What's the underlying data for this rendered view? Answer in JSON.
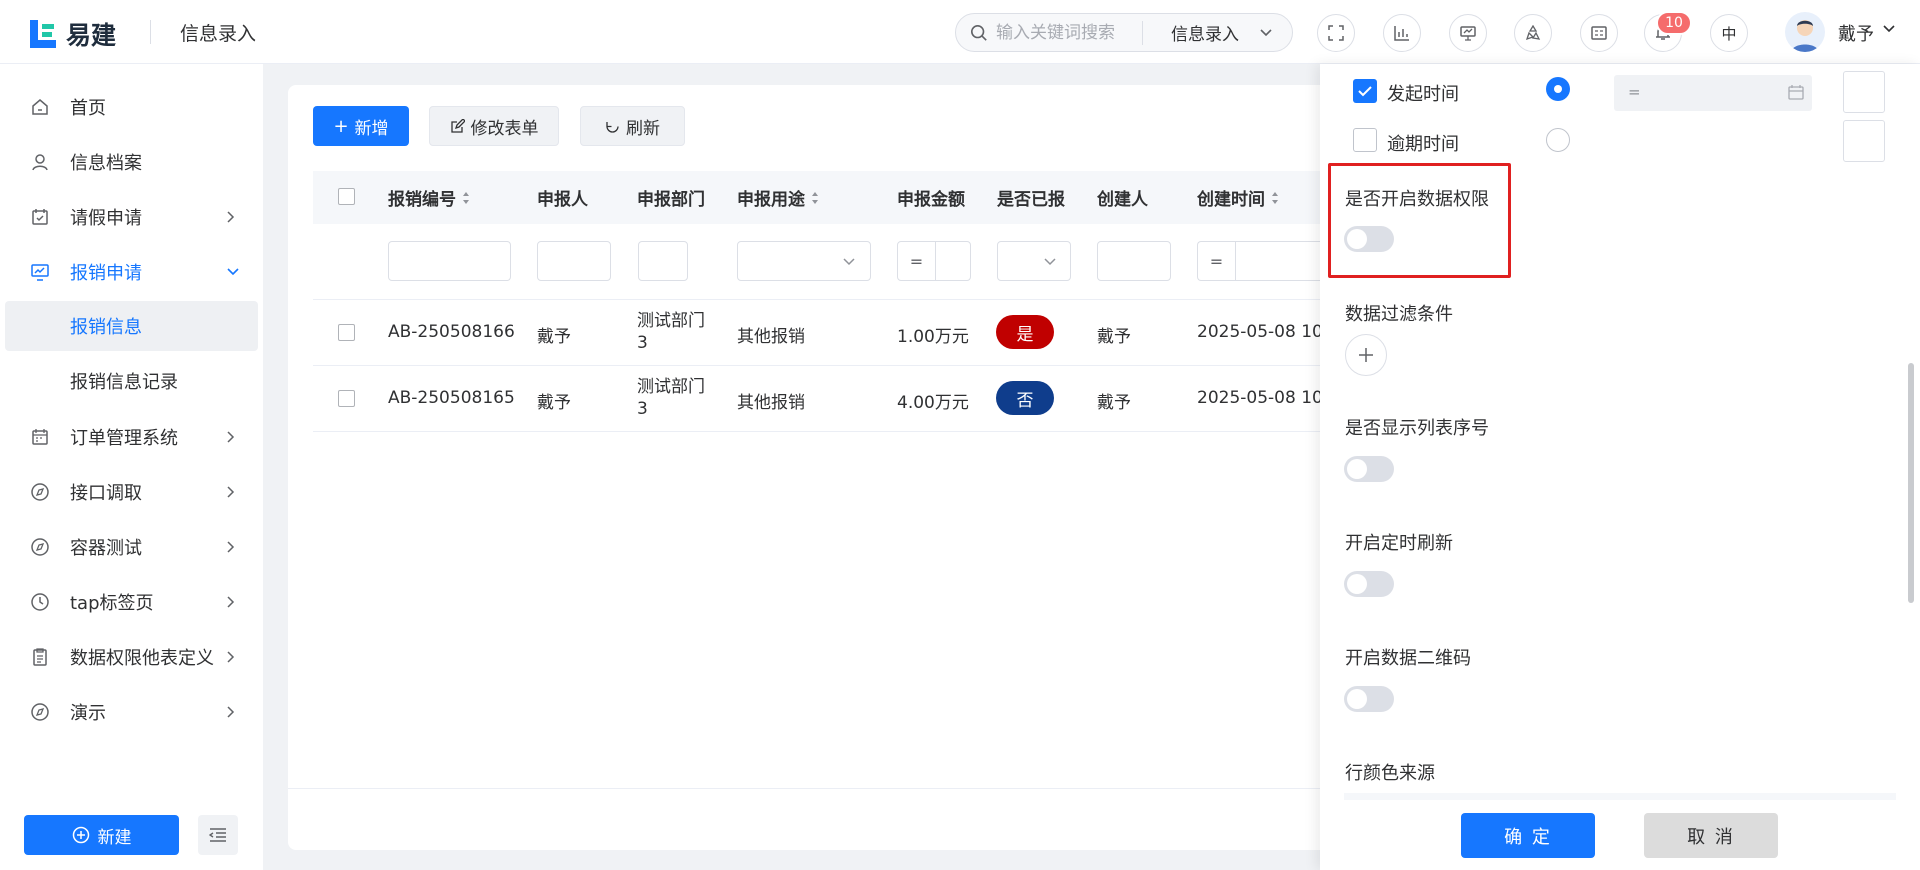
{
  "header": {
    "logo_text": "易建",
    "page_title": "信息录入",
    "search_placeholder": "输入关键词搜索",
    "search_scope": "信息录入",
    "notification_count": "10",
    "lang": "中",
    "user_name": "戴予"
  },
  "sidebar": {
    "items": [
      {
        "label": "首页",
        "icon": "home-icon"
      },
      {
        "label": "信息档案",
        "icon": "user-icon"
      },
      {
        "label": "请假申请",
        "icon": "calendar-check-icon"
      },
      {
        "label": "报销申请",
        "icon": "monitor-chart-icon"
      },
      {
        "label": "报销信息"
      },
      {
        "label": "报销信息记录"
      },
      {
        "label": "订单管理系统",
        "icon": "calendar-icon"
      },
      {
        "label": "接口调取",
        "icon": "compass-icon"
      },
      {
        "label": "容器测试",
        "icon": "compass-icon"
      },
      {
        "label": "tap标签页",
        "icon": "clock-icon"
      },
      {
        "label": "数据权限他表定义",
        "icon": "clipboard-icon"
      },
      {
        "label": "演示",
        "icon": "compass-icon"
      }
    ],
    "new_button": "新建"
  },
  "toolbar": {
    "add": "新增",
    "edit_form": "修改表单",
    "refresh": "刷新"
  },
  "table": {
    "columns": [
      "报销编号",
      "申报人",
      "申报部门",
      "申报用途",
      "申报金额",
      "是否已报",
      "创建人",
      "创建时间"
    ],
    "filter_eq": "=",
    "rows": [
      {
        "id": "AB-250508166",
        "applicant": "戴予",
        "dept_line1": "测试部门",
        "dept_line2": "3",
        "purpose": "其他报销",
        "amount": "1.00万元",
        "reported": "是",
        "creator": "戴予",
        "created": "2025-05-08 10"
      },
      {
        "id": "AB-250508165",
        "applicant": "戴予",
        "dept_line1": "测试部门",
        "dept_line2": "3",
        "purpose": "其他报销",
        "amount": "4.00万元",
        "reported": "否",
        "creator": "戴予",
        "created": "2025-05-08 10"
      }
    ]
  },
  "colors": {
    "primary": "#1677ff",
    "tag_yes": "#c00000",
    "tag_no": "#0f3d8c",
    "highlight": "#e02020"
  },
  "panel": {
    "field_start_time": "发起时间",
    "field_overdue_time": "逾期时间",
    "date_eq": "=",
    "enable_data_permission": "是否开启数据权限",
    "data_filter_conditions": "数据过滤条件",
    "show_row_index": "是否显示列表序号",
    "enable_timed_refresh": "开启定时刷新",
    "enable_qr_code": "开启数据二维码",
    "row_color_source": "行颜色来源",
    "confirm": "确 定",
    "cancel": "取 消"
  }
}
